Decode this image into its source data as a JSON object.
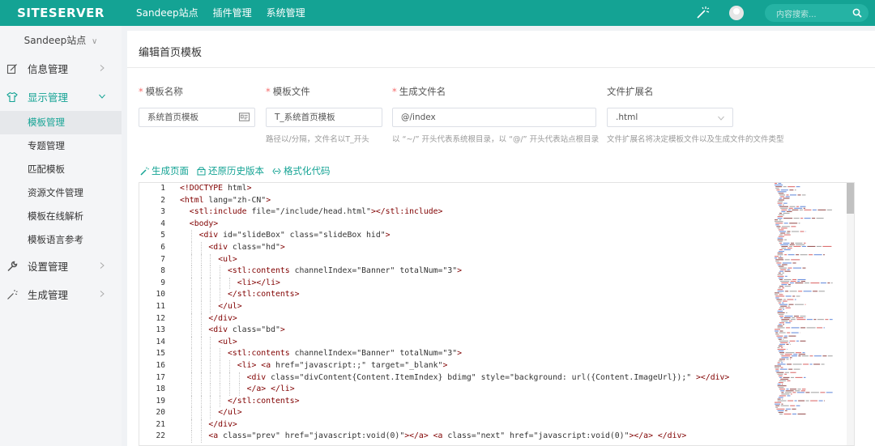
{
  "brand": {
    "logo_text": "SITESERVER",
    "accent": "#14a394"
  },
  "topnav": {
    "items": [
      "Sandeep站点",
      "插件管理",
      "系统管理"
    ]
  },
  "search": {
    "placeholder": "内容搜索..."
  },
  "sidebar": {
    "site_switch": "Sandeep站点",
    "menus": [
      {
        "label": "信息管理",
        "icon": "edit-icon"
      },
      {
        "label": "显示管理",
        "icon": "shirt-icon"
      },
      {
        "label": "设置管理",
        "icon": "wrench-icon"
      },
      {
        "label": "生成管理",
        "icon": "magic-wand-icon"
      }
    ],
    "sub_items": [
      "模板管理",
      "专题管理",
      "匹配模板",
      "资源文件管理",
      "模板在线解析",
      "模板语言参考"
    ]
  },
  "page": {
    "title": "编辑首页模板"
  },
  "form": {
    "name": {
      "label": "模板名称",
      "value": "系统首页模板"
    },
    "file": {
      "label": "模板文件",
      "value": "T_系统首页模板",
      "help": "路径以/分隔，文件名以T_开头"
    },
    "create": {
      "label": "生成文件名",
      "value": "@/index",
      "help": "以 “~/” 开头代表系统根目录，以 “@/” 开头代表站点根目录"
    },
    "ext": {
      "label": "文件扩展名",
      "value": ".html",
      "help": "文件扩展名将决定模板文件以及生成文件的文件类型"
    }
  },
  "actions": {
    "generate": "生成页面",
    "restore": "还原历史版本",
    "format": "格式化代码"
  },
  "editor": {
    "line_numbers": [
      "1",
      "2",
      "3",
      "4",
      "5",
      "6",
      "7",
      "8",
      "9",
      "10",
      "11",
      "12",
      "13",
      "14",
      "15",
      "16",
      "17",
      "18",
      "19",
      "20",
      "21",
      "22"
    ],
    "lines": [
      "<!DOCTYPE html>",
      "<html lang=\"zh-CN\">",
      "  <stl:include file=\"/include/head.html\"></stl:include>",
      "  <body>",
      "    <div id=\"slideBox\" class=\"slideBox hid\">",
      "      <div class=\"hd\">",
      "        <ul>",
      "          <stl:contents channelIndex=\"Banner\" totalNum=\"3\">",
      "            <li></li>",
      "          </stl:contents>",
      "        </ul>",
      "      </div>",
      "      <div class=\"bd\">",
      "        <ul>",
      "          <stl:contents channelIndex=\"Banner\" totalNum=\"3\">",
      "            <li> <a href=\"javascript:;\" target=\"_blank\">",
      "              <div class=\"divContent{Content.ItemIndex} bdimg\" style=\"background: url({Content.ImageUrl});\" ></div>",
      "              </a> </li>",
      "          </stl:contents>",
      "        </ul>",
      "      </div>",
      "      <a class=\"prev\" href=\"javascript:void(0)\"></a> <a class=\"next\" href=\"javascript:void(0)\"></a> </div>"
    ]
  }
}
